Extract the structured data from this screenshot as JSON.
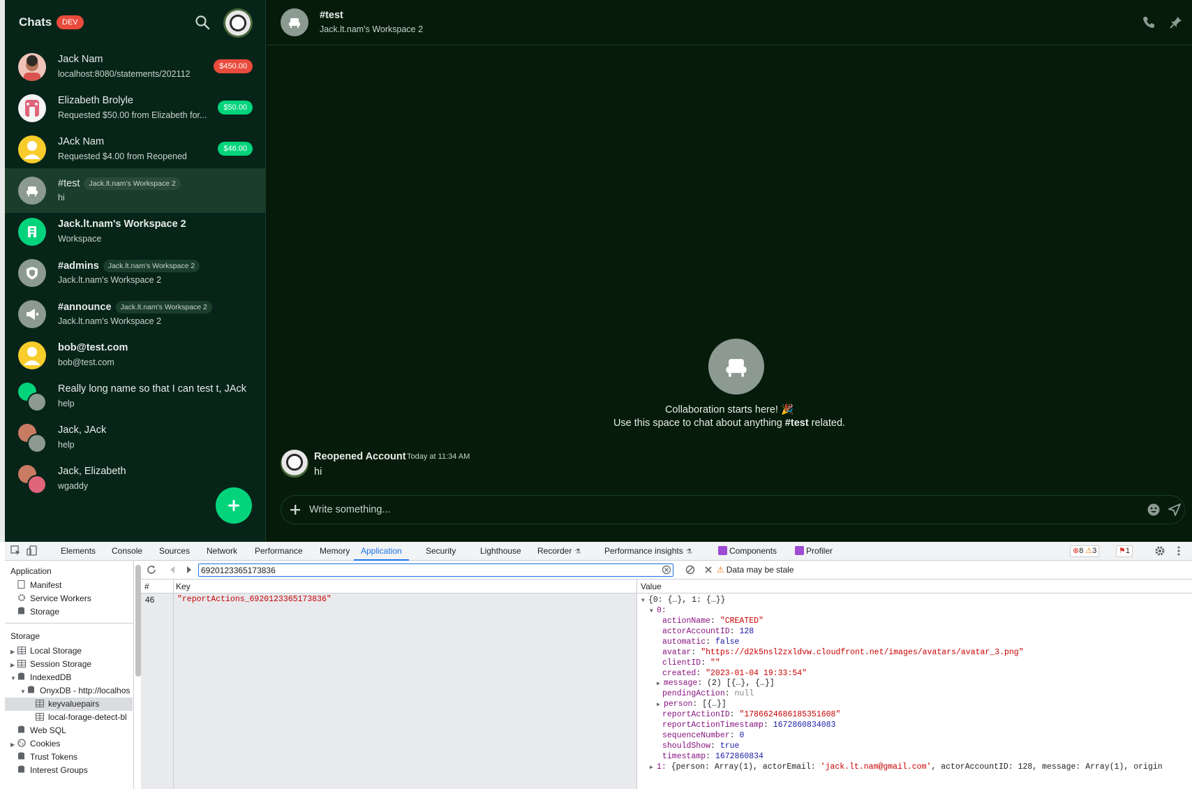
{
  "sidebar": {
    "title": "Chats",
    "badge": "DEV",
    "chats": [
      {
        "name": "Jack Nam",
        "sub": "localhost:8080/statements/202112",
        "amount": "$450.00"
      },
      {
        "name": "Elizabeth Brolyle",
        "sub": "Requested $50.00 from Elizabeth for...",
        "amount": "$50.00"
      },
      {
        "name": "JAck Nam",
        "sub": "Requested $4.00 from Reopened",
        "amount": "$46.00"
      },
      {
        "name": "#test",
        "badge": "Jack.lt.nam's Workspace 2",
        "sub": "hi"
      },
      {
        "name": "Jack.lt.nam's Workspace 2",
        "sub": "Workspace"
      },
      {
        "name": "#admins",
        "badge": "Jack.lt.nam's Workspace 2",
        "sub": "Jack.lt.nam's Workspace 2"
      },
      {
        "name": "#announce",
        "badge": "Jack.lt.nam's Workspace 2",
        "sub": "Jack.lt.nam's Workspace 2"
      },
      {
        "name": "bob@test.com",
        "sub": "bob@test.com"
      },
      {
        "name": "Really long name so that I can test t, JAck",
        "sub": "help"
      },
      {
        "name": "Jack, JAck",
        "sub": "help"
      },
      {
        "name": "Jack, Elizabeth",
        "sub": "wgaddy"
      }
    ]
  },
  "header": {
    "title": "#test",
    "subtitle": "Jack.lt.nam's Workspace 2"
  },
  "welcome": {
    "title": "Collaboration starts here! 🎉",
    "sub_prefix": "Use this space to chat about anything ",
    "sub_bold": "#test",
    "sub_suffix": " related."
  },
  "message": {
    "author": "Reopened Account",
    "time": "Today at 11:34 AM",
    "text": "hi"
  },
  "composer": {
    "placeholder": "Write something..."
  },
  "devtools": {
    "tabs": [
      "Elements",
      "Console",
      "Sources",
      "Network",
      "Performance",
      "Memory",
      "Application",
      "Security",
      "Lighthouse",
      "Recorder",
      "Performance insights",
      "Components",
      "Profiler"
    ],
    "active_tab": "Application",
    "errors": "8",
    "warnings": "3",
    "issues": "1",
    "left": {
      "application_header": "Application",
      "app_items": [
        "Manifest",
        "Service Workers",
        "Storage"
      ],
      "storage_header": "Storage",
      "storage_items": [
        "Local Storage",
        "Session Storage",
        "IndexedDB",
        "OnyxDB - http://localhos",
        "keyvaluepairs",
        "local-forage-detect-bl",
        "Web SQL",
        "Cookies",
        "Trust Tokens",
        "Interest Groups"
      ]
    },
    "filter_value": "6920123365173836",
    "stale": "Data may be stale",
    "columns": {
      "num": "#",
      "key": "Key",
      "value": "Value"
    },
    "row": {
      "num": "46",
      "key": "\"reportActions_6920123365173836\""
    },
    "value_tree": {
      "root": "{0: {…}, 1: {…}}",
      "item0": "0:",
      "fields": [
        {
          "k": "actionName",
          "v": "\"CREATED\"",
          "t": "s"
        },
        {
          "k": "actorAccountID",
          "v": "128",
          "t": "n"
        },
        {
          "k": "automatic",
          "v": "false",
          "t": "n"
        },
        {
          "k": "avatar",
          "v": "\"https://d2k5nsl2zxldvw.cloudfront.net/images/avatars/avatar_3.png\"",
          "t": "s"
        },
        {
          "k": "clientID",
          "v": "\"\"",
          "t": "s"
        },
        {
          "k": "created",
          "v": "\"2023-01-04 19:33:54\"",
          "t": "s"
        },
        {
          "k": "message",
          "v": "(2) [{…}, {…}]",
          "t": "p",
          "expand": true
        },
        {
          "k": "pendingAction",
          "v": "null",
          "t": "null"
        },
        {
          "k": "person",
          "v": "[{…}]",
          "t": "p",
          "expand": true
        },
        {
          "k": "reportActionID",
          "v": "\"1786624686185351608\"",
          "t": "s"
        },
        {
          "k": "reportActionTimestamp",
          "v": "1672860834083",
          "t": "n"
        },
        {
          "k": "sequenceNumber",
          "v": "0",
          "t": "n"
        },
        {
          "k": "shouldShow",
          "v": "true",
          "t": "n"
        },
        {
          "k": "timestamp",
          "v": "1672860834",
          "t": "n"
        }
      ],
      "item1_key": "1:",
      "item1_pre": "{person: Array(1), actorEmail: ",
      "item1_email": "'jack.lt.nam@gmail.com'",
      "item1_post": ", actorAccountID: 128, message: Array(1), origin"
    }
  },
  "colors": {
    "accent_green": "#03d47c",
    "badge_red": "#e94b3c",
    "app_bg": "#061b09",
    "sidebar_bg": "#072419",
    "devtools_blue": "#1a73e8"
  }
}
